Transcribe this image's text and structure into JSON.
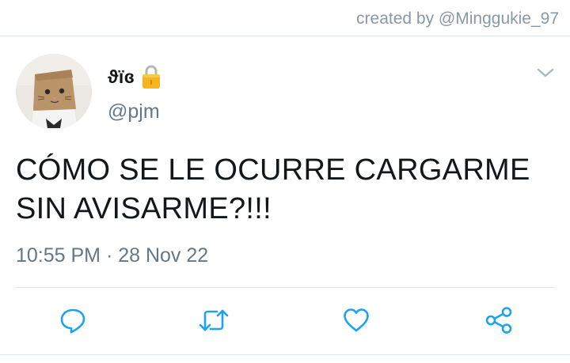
{
  "credit": {
    "text": "created by @Minggukie_97"
  },
  "tweet": {
    "display_name": "ϑïɞ",
    "handle": "@pjm",
    "text_line1": "CÓMO SE LE OCURRE CARGARME",
    "text_line2": "SIN AVISARME?!!!",
    "timestamp": "10:55 PM · 28 Nov 22"
  },
  "icons": {
    "lock": "lock-icon",
    "more": "chevron-down-icon",
    "reply": "reply-icon",
    "retweet": "retweet-icon",
    "like": "heart-icon",
    "share": "share-icon"
  },
  "colors": {
    "text": "#14171a",
    "secondary": "#657786",
    "icon": "#1da1f2",
    "credit": "#8899a6",
    "divider": "#e1e8ed"
  }
}
